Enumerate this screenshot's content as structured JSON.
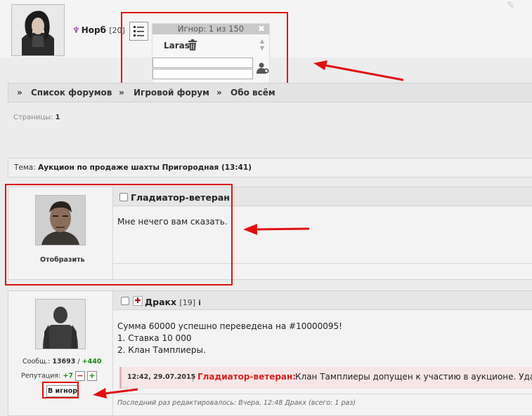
{
  "header": {
    "username": "Норб",
    "level": "[20]",
    "tribe_icon": "clan-sign-icon"
  },
  "ignore_popup": {
    "title": "Игнор: 1 из 150",
    "close_glyph": "✖",
    "entries": [
      {
        "name": "Laras"
      }
    ],
    "input1_value": "",
    "input2_value": ""
  },
  "breadcrumb": {
    "separator": "»",
    "items": [
      "Список форумов",
      "Игровой форум",
      "Обо всём"
    ]
  },
  "pages": {
    "label": "Страницы:",
    "current": "1"
  },
  "topic": {
    "prefix": "Тема:",
    "title": "Аукцион по продаже шахты Пригородная (13:41)"
  },
  "posts": [
    {
      "author": "Гладиатор-ветеран",
      "show_label": "Отобразить",
      "message": "Мне нечего вам сказать."
    },
    {
      "author": "Дракх",
      "level": "[19]",
      "messages_label": "Сообщ.:",
      "messages_count": "13693",
      "messages_separator": "/",
      "messages_delta": "+440",
      "reputation_label": "Репутация:",
      "reputation_value": "+7",
      "rep_minus": "−",
      "rep_plus": "+",
      "ignore_button": "В игнор",
      "lines": [
        "Сумма 60000 успешно переведена на #10000095!",
        "1. Ставка 10 000",
        "2. Клан Тамплиеры."
      ],
      "quote": {
        "time": "12:42, 29.07.2015",
        "separator": "|",
        "author": "Гладиатор-ветеран:",
        "text": "Клан Тамплиеры допущен к участию в аукционе. Удачи!"
      },
      "edited_note": "Последний раз редактировалось: Вчера, 12:48 Дракх (всего: 1 раз)"
    }
  ],
  "colors": {
    "annotation_red": "#e01010",
    "quote_author": "#d42020",
    "reputation_green": "#1a8a1a"
  }
}
